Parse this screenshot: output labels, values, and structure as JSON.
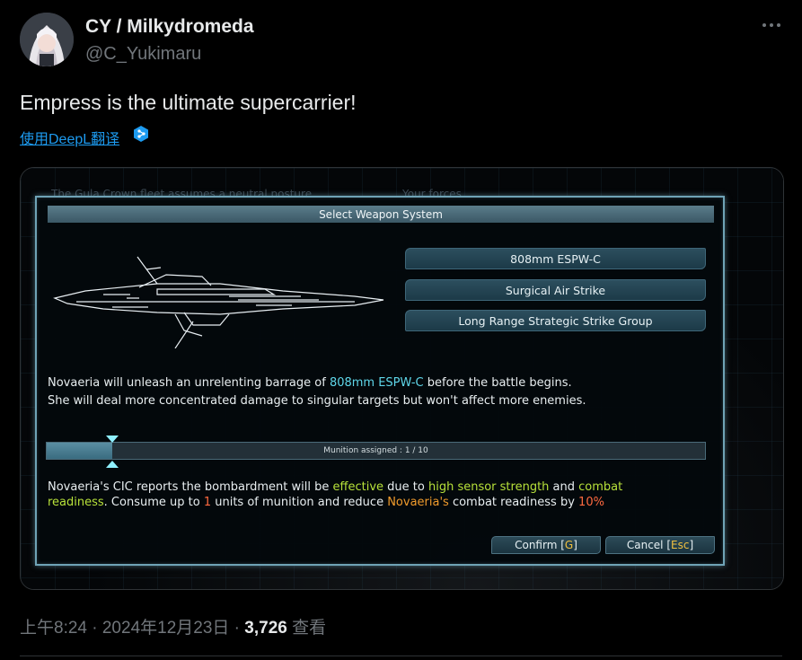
{
  "author": {
    "display_name": "CY / Milkydromeda",
    "handle": "@C_Yukimaru"
  },
  "tweet": {
    "text": "Empress is the ultimate supercarrier!",
    "translate_label": "使用DeepL翻译"
  },
  "game": {
    "background_lines": {
      "left": "The Gula Crown fleet assumes a neutral posture",
      "right": "Your forces"
    },
    "dialog_title": "Select Weapon System",
    "weapons": [
      {
        "label": "808mm ESPW-C"
      },
      {
        "label": "Surgical Air Strike"
      },
      {
        "label": "Long Range Strategic Strike Group"
      }
    ],
    "description": {
      "line1_pre": "Novaeria will unleash an unrelenting barrage of ",
      "line1_hl": "808mm ESPW-C",
      "line1_post": " before the battle begins.",
      "line2": "She will deal more concentrated damage to singular targets but won't affect more enemies."
    },
    "munition": {
      "label": "Munition assigned : 1 / 10",
      "assigned": 1,
      "max": 10
    },
    "report": {
      "p1": "Novaeria's CIC reports the bombardment will be ",
      "effective": "effective",
      "p2": " due to ",
      "sensor": "high sensor strength",
      "p3": " and ",
      "combat": "combat",
      "readiness": "readiness",
      "p4": ". Consume up to ",
      "units": "1",
      "p5": " units of munition and reduce ",
      "ship": "Novaeria's",
      "p6": " combat readiness by ",
      "percent": "10%"
    },
    "confirm": {
      "label": "Confirm [",
      "key": "G",
      "end": "]"
    },
    "cancel": {
      "label": "Cancel [",
      "key": "Esc",
      "end": "]"
    }
  },
  "footer": {
    "time": "上午8:24 · 2024年12月23日 · ",
    "views": "3,726",
    "views_label": " 查看"
  },
  "colors": {
    "accent_link": "#1d9bf0",
    "highlight_cyan": "#5fd7ea",
    "highlight_green": "#b8e23a",
    "highlight_orange": "#f09b2c"
  }
}
